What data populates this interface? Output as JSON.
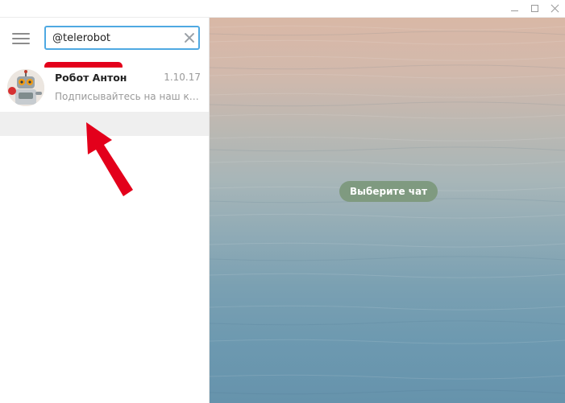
{
  "window": {
    "minimize_icon": "minimize-icon",
    "maximize_icon": "maximize-icon",
    "close_icon": "close-icon"
  },
  "sidebar": {
    "menu_icon": "hamburger-menu-icon",
    "search": {
      "value": "@telerobot",
      "clear_icon": "clear-search-icon"
    }
  },
  "chats": [
    {
      "name": "Робот Антон",
      "date": "1.10.17",
      "preview": "Подписывайтесь на наш канал",
      "avatar_icon": "robot-avatar"
    }
  ],
  "main": {
    "placeholder": "Выберите чат"
  },
  "annotations": {
    "highlight_color": "#e3001b",
    "arrow_icon": "red-arrow-icon"
  },
  "colors": {
    "search_border": "#4fa9e2",
    "pill_background": "#7f9a80"
  }
}
